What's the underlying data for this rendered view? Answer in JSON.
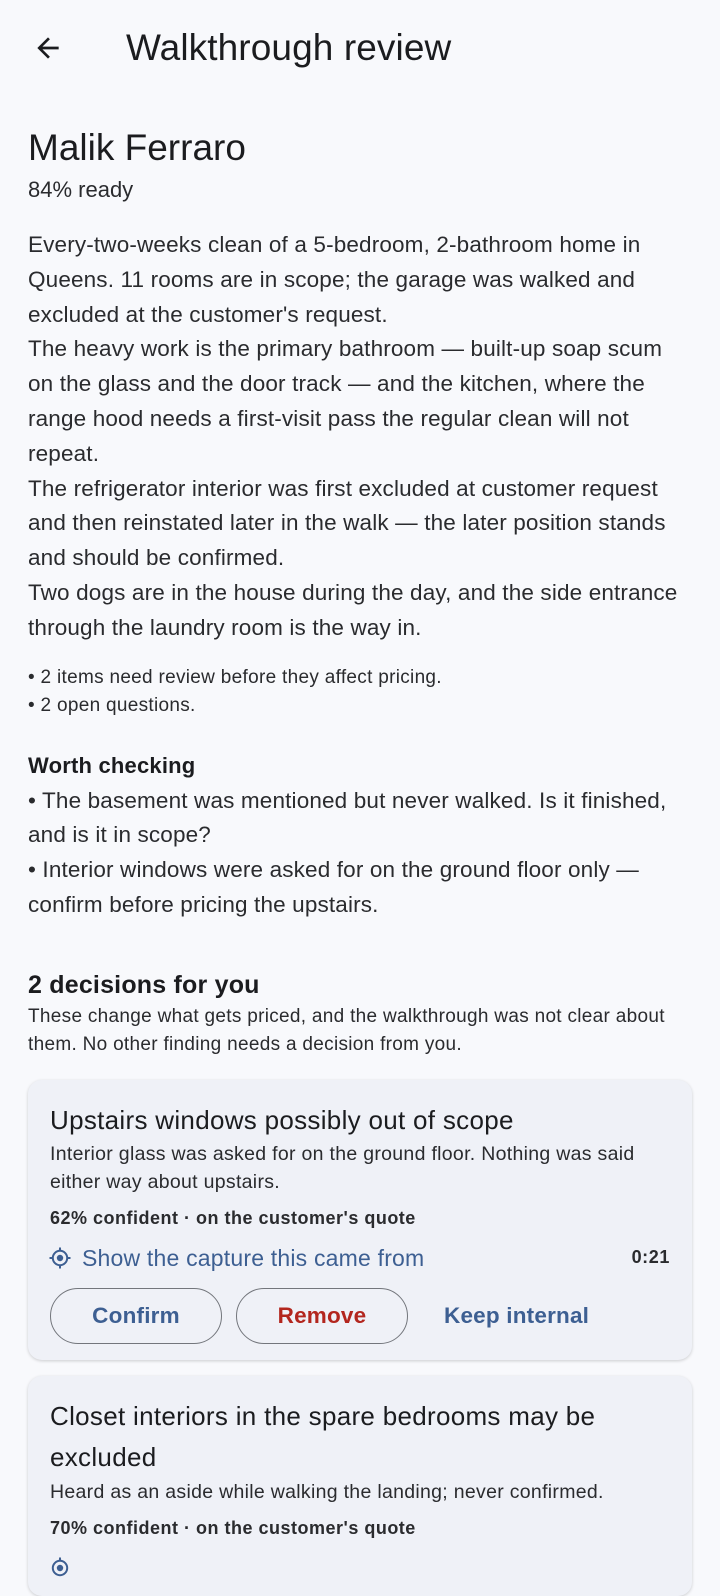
{
  "app_bar": {
    "title": "Walkthrough review",
    "back_icon": "arrow-back-icon"
  },
  "customer": {
    "name": "Malik Ferraro",
    "readiness": "84% ready"
  },
  "summary": {
    "paragraphs": [
      "Every-two-weeks clean of a 5-bedroom, 2-bathroom home in Queens. 11 rooms are in scope; the garage was walked and excluded at the customer's request.",
      "The heavy work is the primary bathroom — built-up soap scum on the glass and the door track — and the kitchen, where the range hood needs a first-visit pass the regular clean will not repeat.",
      "The refrigerator interior was first excluded at customer request and then reinstated later in the walk — the later position stands and should be confirmed.",
      "Two dogs are in the house during the day, and the side entrance through the laundry room is the way in."
    ]
  },
  "status_bullets": [
    "• 2 items need review before they affect pricing.",
    "• 2 open questions."
  ],
  "worth_checking": {
    "heading": "Worth checking",
    "items": [
      "• The basement was mentioned but never walked. Is it finished, and is it in scope?",
      "• Interior windows were asked for on the ground floor only — confirm before pricing the upstairs."
    ]
  },
  "decisions": {
    "heading": "2 decisions for you",
    "subtitle": "These change what gets priced, and the walkthrough was not clear about them. No other finding needs a decision from you.",
    "cards": [
      {
        "title": "Upstairs windows possibly out of scope",
        "body": "Interior glass was asked for on the ground floor. Nothing was said either way about upstairs.",
        "meta": "62% confident · on the customer's quote",
        "source_link": "Show the capture this came from",
        "timestamp": "0:21",
        "confirm_label": "Confirm",
        "remove_label": "Remove",
        "keep_internal_label": "Keep internal"
      },
      {
        "title": "Closet interiors in the spare bedrooms may be excluded",
        "body": "Heard as an aside while walking the landing; never confirmed.",
        "meta": "70% confident · on the customer's quote"
      }
    ]
  },
  "colors": {
    "background": "#f8f9fc",
    "card": "#eff1f7",
    "primary": "#3d5f92",
    "error": "#b3261e",
    "outline": "#73767c"
  }
}
